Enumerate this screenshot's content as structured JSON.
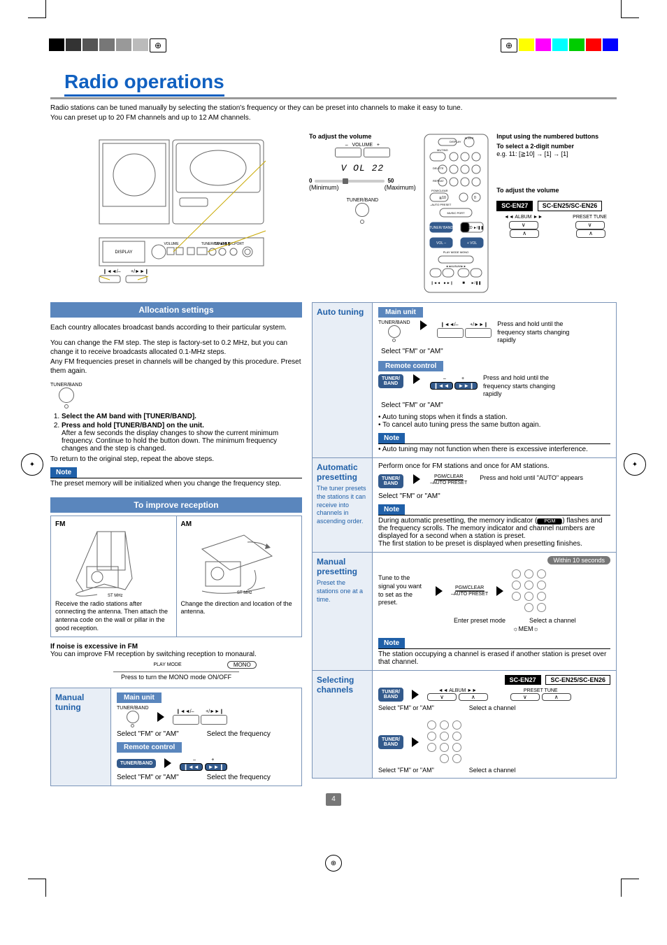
{
  "title": "Radio operations",
  "intro": {
    "line1": "Radio stations can be tuned manually by selecting the station's frequency or they can be preset into channels to make it easy to tune.",
    "line2": "You can preset up to 20 FM channels and up to 12 AM channels."
  },
  "volume_panel": {
    "label": "To adjust the volume",
    "volume_text": "VOLUME",
    "display": "V OL 22",
    "min_val": "0",
    "max_val": "50",
    "min_label": "(Minimum)",
    "max_label": "(Maximum)",
    "tb_text": "TUNER/BAND"
  },
  "remote_panel": {
    "heading1": "Input using the numbered buttons",
    "heading2": "To select a 2-digit number",
    "example": "e.g. 11: [≧10] → [1] → [1]",
    "adjust": "To adjust the volume",
    "model_a": "SC-EN27",
    "model_b": "SC-EN25/SC-EN26",
    "album_label": "◄◄ ALBUM ►►",
    "preset_label": "PRESET TUNE",
    "btn_tb": "TUNER/BAND",
    "btn_cd": "CD ►/❚❚",
    "btn_vol_minus": "VOL –",
    "btn_vol_plus": "+ VOL",
    "btn_display": "DISPLAY",
    "btn_sleep": "SLEEP",
    "btn_pgm": "PGM/CLEAR",
    "btn_auto": "–AUTO PRESET",
    "btn_music": "MUSIC PORT",
    "btn_ge10": "≧10",
    "btn_0": "0"
  },
  "allocation": {
    "title": "Allocation settings",
    "line1": "Each country allocates broadcast bands according to their particular system.",
    "line2": "You can change the FM step. The step is factory-set to 0.2 MHz, but you can change it to receive broadcasts allocated 0.1-MHz steps.",
    "line3": "Any FM frequencies preset in channels will be changed by this procedure. Preset them again.",
    "knob_label": "TUNER/BAND",
    "step1": "Select the AM band with [TUNER/BAND].",
    "step2": "Press and hold [TUNER/BAND] on the unit.",
    "step2b": "After a few seconds the display changes to show the current minimum frequency. Continue to hold the button down. The minimum frequency changes and the step is changed.",
    "return": "To return to the original step, repeat the above steps.",
    "note_label": "Note",
    "note_body": "The preset memory will be initialized when you change the frequency step."
  },
  "reception": {
    "title": "To improve reception",
    "fm_label": "FM",
    "am_label": "AM",
    "fm_text": "Receive the radio stations after connecting the antenna. Then attach the antenna code on the wall or pillar in the good reception.",
    "am_text": "Change the direction and location of the antenna.",
    "noisy_title": "If noise is excessive in FM",
    "noisy_text": "You can improve FM reception by switching reception to monaural.",
    "playmode": "PLAY MODE",
    "mono_btn": "MONO",
    "mono_caption": "Press to turn the MONO mode ON/OFF"
  },
  "manual_tuning_left": {
    "title": "Manual tuning",
    "main_unit": "Main unit",
    "remote": "Remote control",
    "tb": "TUNER/BAND",
    "sel_fm_am": "Select \"FM\" or \"AM\"",
    "sel_freq": "Select the frequency",
    "prev": "❙◄◄/–",
    "next": "+/►►❙",
    "minus": "–",
    "plus": "+"
  },
  "auto_tuning": {
    "title": "Auto tuning",
    "main_unit": "Main unit",
    "remote": "Remote control",
    "tb": "TUNER/BAND",
    "sel_fm_am": "Select \"FM\" or \"AM\"",
    "instr": "Press and hold until the frequency starts changing rapidly",
    "bullet1": "• Auto tuning stops when it finds a station.",
    "bullet2": "• To cancel auto tuning press the same button again.",
    "note_label": "Note",
    "note_body": "• Auto tuning may not function when there is excessive interference.",
    "prev": "❙◄◄/–",
    "next": "+/►►❙",
    "minus": "–",
    "plus": "+"
  },
  "auto_preset": {
    "title": "Automatic presetting",
    "desc": "The tuner presets the stations it can receive into channels in ascending order.",
    "perform": "Perform once for FM stations and once for AM stations.",
    "pgm": "PGM/CLEAR",
    "auto": "–AUTO PRESET",
    "tb_pill": "TUNER/BAND",
    "sel_fm_am": "Select \"FM\" or \"AM\"",
    "instr": "Press and hold until \"AUTO\" appears",
    "note_label": "Note",
    "note_body1": "During automatic presetting, the memory indicator (",
    "pgm_inline": "PGM",
    "note_body1b": ") flashes and the frequency scrolls. The memory indicator and channel numbers are displayed for a second when a station is preset.",
    "note_body2": "The first station to be preset is displayed when presetting finishes."
  },
  "manual_preset": {
    "title": "Manual presetting",
    "desc": "Preset the stations one at a time.",
    "within": "Within 10 seconds",
    "tune": "Tune to the signal you want to set as the preset.",
    "pgm": "PGM/CLEAR",
    "auto": "–AUTO PRESET",
    "enter": "Enter preset mode",
    "selch": "Select a channel",
    "note_label": "Note",
    "note_body": "The station occupying a channel is erased if another station is preset over that channel.",
    "flash_icon": "☼MEM☼"
  },
  "sel_channels": {
    "title": "Selecting channels",
    "tb_pill": "TUNER/BAND",
    "sel_fm_am": "Select \"FM\" or \"AM\"",
    "selch": "Select a channel",
    "model_a": "SC-EN27",
    "model_b": "SC-EN25/SC-EN26",
    "album_label": "◄◄ ALBUM ►►",
    "preset_label": "PRESET TUNE",
    "v_btn": "∨",
    "a_btn": "∧"
  },
  "page_number": "4"
}
